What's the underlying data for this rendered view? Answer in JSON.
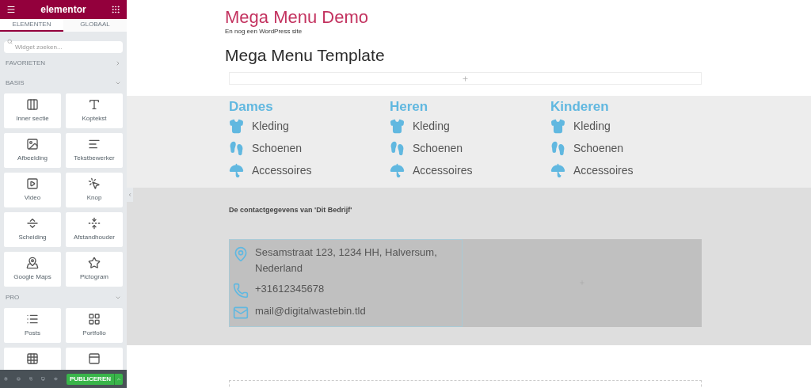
{
  "sidebar": {
    "title": "elementor",
    "tabs": [
      {
        "label": "ELEMENTEN",
        "selected": true
      },
      {
        "label": "GLOBAAL",
        "selected": false
      }
    ],
    "search": {
      "placeholder": "Widget zoeken..."
    },
    "sections": [
      {
        "title": "FAVORIETEN",
        "expanded": false
      },
      {
        "title": "BASIS",
        "expanded": true,
        "widgets": [
          {
            "kind": "columns",
            "label": "Inner sectie"
          },
          {
            "kind": "heading",
            "label": "Koptekst"
          },
          {
            "kind": "image",
            "label": "Afbeelding"
          },
          {
            "kind": "text",
            "label": "Tekstbewerker"
          },
          {
            "kind": "video",
            "label": "Video"
          },
          {
            "kind": "button",
            "label": "Knop"
          },
          {
            "kind": "divider",
            "label": "Scheiding"
          },
          {
            "kind": "spacer",
            "label": "Afstandhouder"
          },
          {
            "kind": "map",
            "label": "Google Maps"
          },
          {
            "kind": "star",
            "label": "Pictogram"
          }
        ]
      },
      {
        "title": "PRO",
        "expanded": true,
        "widgets": [
          {
            "kind": "list",
            "label": "Posts"
          },
          {
            "kind": "grid",
            "label": "Portfolio"
          },
          {
            "kind": "gallery"
          },
          {
            "kind": "slides"
          }
        ]
      }
    ],
    "footer": {
      "publish": "PUBLICEREN"
    }
  },
  "page": {
    "site_title": "Mega Menu Demo",
    "tagline": "En nog een WordPress site",
    "heading": "Mega Menu Template",
    "menu_columns": [
      {
        "title": "Dames",
        "items": [
          {
            "kind": "shirt",
            "label": "Kleding"
          },
          {
            "kind": "shoes",
            "label": "Schoenen"
          },
          {
            "kind": "umbrella",
            "label": "Accessoires"
          }
        ]
      },
      {
        "title": "Heren",
        "items": [
          {
            "kind": "shirt",
            "label": "Kleding"
          },
          {
            "kind": "shoes",
            "label": "Schoenen"
          },
          {
            "kind": "umbrella",
            "label": "Accessoires"
          }
        ]
      },
      {
        "title": "Kinderen",
        "items": [
          {
            "kind": "shirt",
            "label": "Kleding"
          },
          {
            "kind": "shoes",
            "label": "Schoenen"
          },
          {
            "kind": "umbrella",
            "label": "Accessoires"
          }
        ]
      }
    ],
    "contact_heading": "De contactgegevens van 'Dit Bedrijf'",
    "contact": [
      {
        "kind": "pin",
        "text": "Sesamstraat 123, 1234 HH, Halversum, Nederland"
      },
      {
        "kind": "phone",
        "text": "+31612345678"
      },
      {
        "kind": "mail",
        "text": "mail@digitalwastebin.tld"
      }
    ]
  }
}
